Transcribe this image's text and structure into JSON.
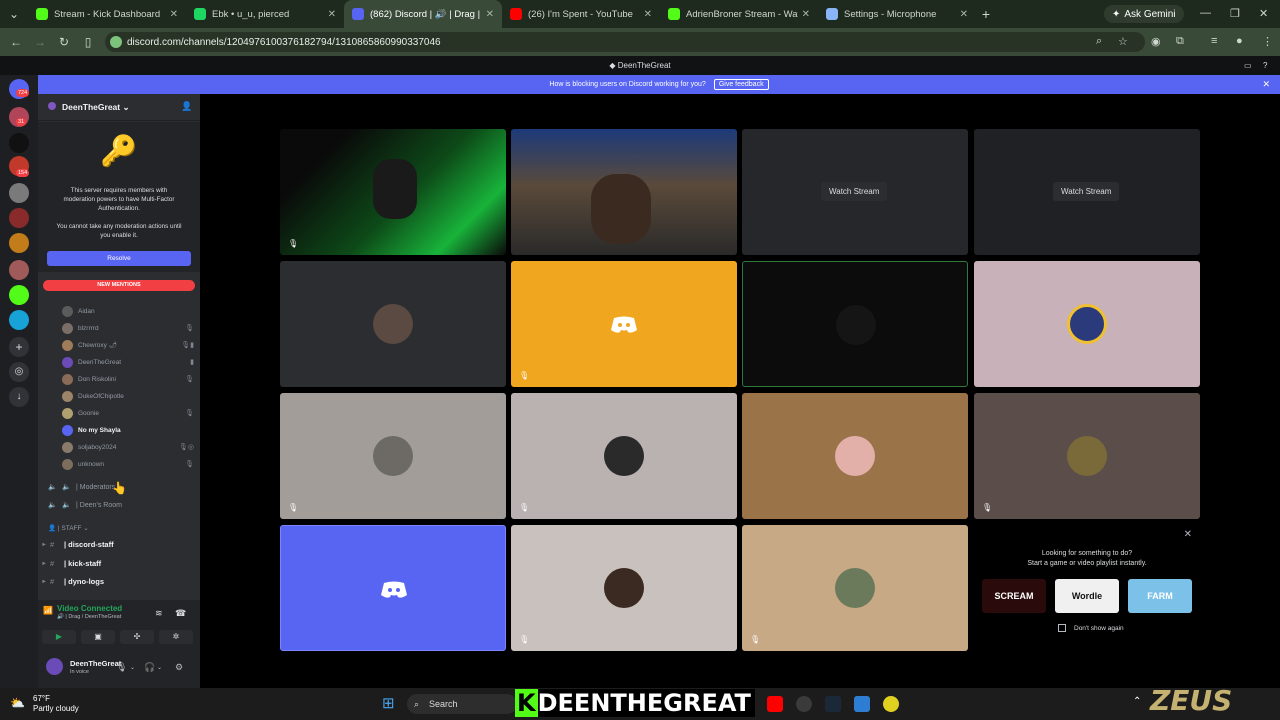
{
  "browser": {
    "tabs": [
      {
        "title": "Stream - Kick Dashboard",
        "color": "#53fc18",
        "active": false
      },
      {
        "title": "Ebk • u_u, pierced",
        "color": "#1ed760",
        "active": false
      },
      {
        "title": "(862) Discord | 🔊 | Drag | D",
        "color": "#5865f2",
        "active": true
      },
      {
        "title": "(26) I'm Spent - YouTube",
        "color": "#ff0000",
        "active": false
      },
      {
        "title": "AdrienBroner Stream - Watch L",
        "color": "#53fc18",
        "active": false
      },
      {
        "title": "Settings - Microphone",
        "color": "#8ab4f8",
        "active": false
      }
    ],
    "new_tab_label": "+",
    "gemini_label": "Ask Gemini",
    "url": "discord.com/channels/1204976100376182794/1310865860990337046"
  },
  "discord": {
    "window_title": "DeenTheGreat",
    "banner": {
      "text": "How is blocking users on Discord working for you?",
      "button": "Give feedback",
      "close": "✕"
    },
    "rail_badges": [
      "724",
      "31",
      "154"
    ],
    "server_name": "DeenTheGreat",
    "mfa": {
      "line1": "This server requires members with",
      "line2": "moderation powers to have Multi-Factor",
      "line3": "Authentication.",
      "line4": "You cannot take any moderation actions until",
      "line5": "you enable it.",
      "button": "Resolve"
    },
    "new_mentions": "NEW MENTIONS",
    "members": [
      {
        "name": "Aidan",
        "bright": false,
        "right": "",
        "color": "#5b5b5b"
      },
      {
        "name": "blzrrrrd",
        "bright": false,
        "right": "🎙",
        "color": "#7a6e66"
      },
      {
        "name": "Chewroxy 🌶",
        "bright": false,
        "right": "🎙▮",
        "color": "#a07c5a"
      },
      {
        "name": "DeenTheGreat",
        "bright": false,
        "right": "▮",
        "color": "#6a4bb8"
      },
      {
        "name": "Don Riskolini",
        "bright": false,
        "right": "🎙",
        "color": "#8a6b57"
      },
      {
        "name": "DukeOfChipotle",
        "bright": false,
        "right": "",
        "color": "#9b8468"
      },
      {
        "name": "Goonie",
        "bright": false,
        "right": "🎙",
        "color": "#b0a070"
      },
      {
        "name": "No my Shayla",
        "bright": true,
        "right": "",
        "color": "#5865f2"
      },
      {
        "name": "soljaboy2024",
        "bright": false,
        "right": "🎙◎",
        "color": "#8a7a6a"
      },
      {
        "name": "unknown",
        "bright": false,
        "right": "🎙",
        "color": "#7d6d5d"
      }
    ],
    "voice_channels": [
      "| Moderators",
      "| Deen's Room"
    ],
    "staff_category": "| STAFF ⌄",
    "text_channels": [
      "| discord-staff",
      "| kick-staff",
      "| dyno-logs"
    ],
    "voice_panel": {
      "status": "Video Connected",
      "channel": "🔊 | Drag / DeenTheGreat"
    },
    "user": {
      "name": "DeenTheGreat",
      "status": "In voice"
    },
    "tiles": {
      "watch_stream": "Watch Stream"
    },
    "activity": {
      "line1": "Looking for something to do?",
      "line2": "Start a game or video playlist instantly.",
      "games": [
        "SCREAM",
        "Wordle",
        "FARM"
      ],
      "dont_show": "Don't show again"
    }
  },
  "taskbar": {
    "temp": "67°F",
    "weather": "Partly cloudy",
    "search": "Search",
    "overlay_k": "K",
    "overlay_text": "DEENTHEGREAT",
    "watermark": "ZEUS"
  }
}
